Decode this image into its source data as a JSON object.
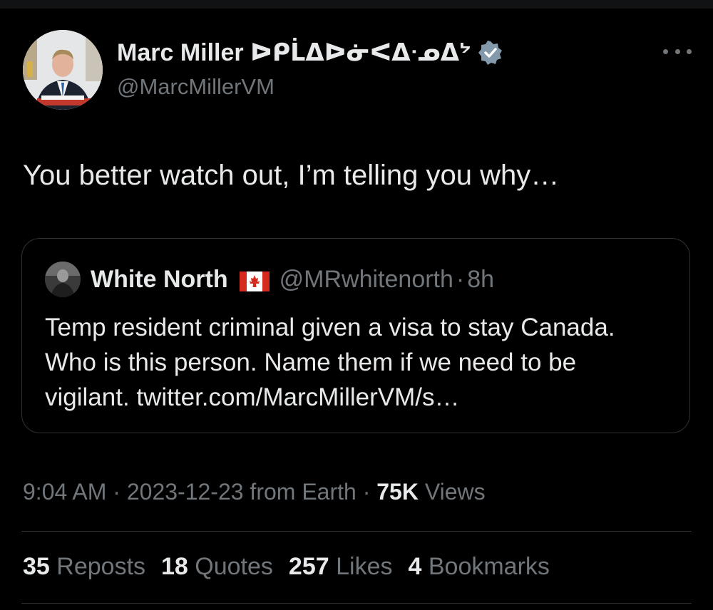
{
  "author": {
    "display_name": "Marc Miller ᐅᑭᒫᐃᐅᓃᐸᐃᐧᓄᐃᔾ",
    "handle": "@MarcMillerVM",
    "verified_icon": "verified-badge-icon",
    "avatar_icon": "avatar-photo"
  },
  "tweet": {
    "text": "You better watch out, I’m telling you why…"
  },
  "quoted_tweet": {
    "display_name": "White North",
    "flag_icon": "canada-flag-icon",
    "handle": "@MRwhitenorth",
    "separator": "·",
    "time": "8h",
    "lines": [
      "Temp resident criminal given a visa to stay Canada.",
      "Who is this person. Name them if we need to be",
      "vigilant. twitter.com/MarcMillerVM/s…"
    ]
  },
  "meta": {
    "time": "9:04 AM",
    "date": "2023-12-23",
    "source": "from Earth",
    "separator": "·",
    "views_count": "75K",
    "views_label": "Views"
  },
  "stats": [
    {
      "count": "35",
      "label": "Reposts"
    },
    {
      "count": "18",
      "label": "Quotes"
    },
    {
      "count": "257",
      "label": "Likes"
    },
    {
      "count": "4",
      "label": "Bookmarks"
    }
  ],
  "colors": {
    "background": "#000000",
    "primary_text": "#e7e9ea",
    "secondary_text": "#71767b",
    "border": "#2f3336",
    "verified": "#829aab"
  }
}
